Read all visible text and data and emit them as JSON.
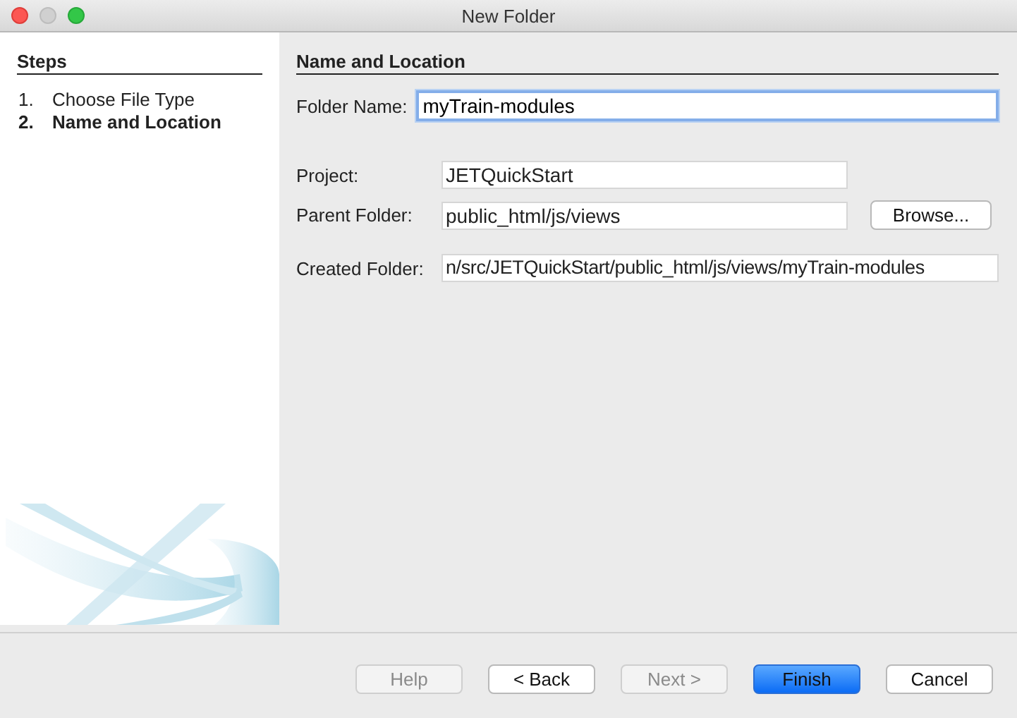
{
  "window": {
    "title": "New Folder"
  },
  "steps": {
    "heading": "Steps",
    "items": [
      {
        "number": "1.",
        "label": "Choose File Type",
        "selected": false
      },
      {
        "number": "2.",
        "label": "Name and Location",
        "selected": true
      }
    ]
  },
  "panel": {
    "heading": "Name and Location",
    "folder_name": {
      "label": "Folder Name:",
      "value": "myTrain-modules",
      "focused": true
    },
    "fields": [
      {
        "label": "Project:",
        "value": "JETQuickStart",
        "kind": "short"
      },
      {
        "label": "Parent Folder:",
        "value": "public_html/js/views",
        "kind": "browse",
        "button": "Browse..."
      },
      {
        "label": "Created Folder:",
        "value": "n/src/JETQuickStart/public_html/js/views/myTrain-modules",
        "kind": "wide"
      }
    ]
  },
  "buttons": [
    {
      "label": "Help",
      "disabled": true,
      "primary": false
    },
    {
      "label": "< Back",
      "disabled": false,
      "primary": false
    },
    {
      "label": "Next >",
      "disabled": true,
      "primary": false
    },
    {
      "label": "Finish",
      "disabled": false,
      "primary": true
    },
    {
      "label": "Cancel",
      "disabled": false,
      "primary": false
    }
  ]
}
